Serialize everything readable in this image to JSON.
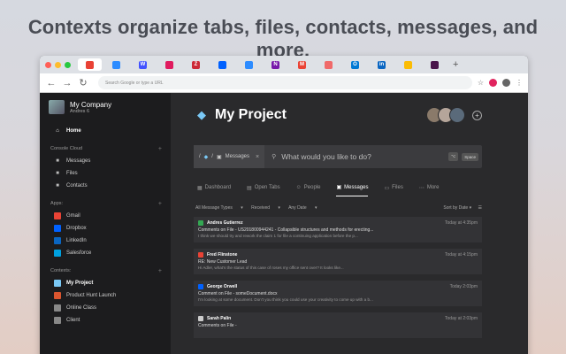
{
  "headline": "Contexts organize tabs, files, contacts, messages, and more.",
  "colors": {
    "accent": "#7ac8f5",
    "dark_bg": "#2a2a2c",
    "sidebar_bg": "#1c1c1e"
  },
  "browser": {
    "omnibox_placeholder": "Search Google or type a URL",
    "tabs": [
      {
        "icon": "chrome-app-icon",
        "color": "#e94235",
        "text": ""
      },
      {
        "icon": "zoom-icon",
        "color": "#2d8cff",
        "text": ""
      },
      {
        "icon": "webflow-icon",
        "color": "#4353ff",
        "text": "W"
      },
      {
        "icon": "toggl-icon",
        "color": "#e01b5f",
        "text": ""
      },
      {
        "icon": "zotero-icon",
        "color": "#cc2936",
        "text": "Z"
      },
      {
        "icon": "dropbox-icon",
        "color": "#0061ff",
        "text": ""
      },
      {
        "icon": "zoom-icon-2",
        "color": "#2d8cff",
        "text": ""
      },
      {
        "icon": "onenote-icon",
        "color": "#7719aa",
        "text": "N"
      },
      {
        "icon": "gmail-icon",
        "color": "#ea4335",
        "text": "M"
      },
      {
        "icon": "app-icon",
        "color": "#f06a6a",
        "text": ""
      },
      {
        "icon": "outlook-icon",
        "color": "#0078d4",
        "text": "O"
      },
      {
        "icon": "linkedin-icon",
        "color": "#0a66c2",
        "text": "in"
      },
      {
        "icon": "photos-icon",
        "color": "#fbbc04",
        "text": ""
      },
      {
        "icon": "slack-icon",
        "color": "#4a154b",
        "text": ""
      }
    ]
  },
  "sidebar": {
    "company": "My Company",
    "user": "Andres 6",
    "home": "Home",
    "cc_section": "Console Cloud",
    "cc_items": [
      {
        "label": "Messages",
        "icon": "inbox-icon"
      },
      {
        "label": "Files",
        "icon": "folder-icon"
      },
      {
        "label": "Contacts",
        "icon": "contact-icon"
      }
    ],
    "apps_section": "Apps:",
    "apps": [
      {
        "label": "Gmail",
        "icon": "gmail-icon",
        "color": "#ea4335"
      },
      {
        "label": "Dropbox",
        "icon": "dropbox-icon",
        "color": "#0061ff"
      },
      {
        "label": "LinkedIn",
        "icon": "linkedin-icon",
        "color": "#0a66c2"
      },
      {
        "label": "Salesforce",
        "icon": "salesforce-icon",
        "color": "#00a1e0"
      }
    ],
    "contexts_section": "Contexts:",
    "contexts": [
      {
        "label": "My Project",
        "icon": "gem-icon",
        "color": "#7ac8f5",
        "bold": true
      },
      {
        "label": "Product Hunt Launch",
        "icon": "producthunt-icon",
        "color": "#da552f",
        "bold": false
      },
      {
        "label": "Online Class",
        "icon": "class-icon",
        "color": "#888",
        "bold": false
      },
      {
        "label": "Client",
        "icon": "client-icon",
        "color": "#888",
        "bold": false
      }
    ]
  },
  "main": {
    "title": "My Project",
    "breadcrumb_label": "Messages",
    "command_placeholder": "What would you like to do?",
    "kbd_1": "⌥",
    "kbd_2": "Space",
    "tabs": [
      "Dashboard",
      "Open Tabs",
      "People",
      "Messages",
      "Files",
      "More"
    ],
    "active_tab": "Messages",
    "filters": [
      "All Message Types",
      "Received",
      "Any Date"
    ],
    "sort": "Sort by Date",
    "messages": [
      {
        "from": "Andres Gutierrez",
        "icon_color": "#34a853",
        "time": "Today at 4:35pm",
        "subject": "Comments on File - US201800944241 - Collapsible structures and methods for erecting...",
        "body": "I think we should try and rework the claim 1 for file a continuing application before the p..."
      },
      {
        "from": "Fred Flinstone",
        "icon_color": "#ea4335",
        "time": "Today at 4:15pm",
        "subject": "RE: New Customer Lead",
        "body": "Hi Adler, what's the status of this case of roses my office sent over? It looks like..."
      },
      {
        "from": "George Orwell",
        "icon_color": "#0061ff",
        "time": "Today 2:03pm",
        "subject": "Comment on File - someDocument.docx",
        "body": "I'm looking at some document. Don't you think you could use your creativity to come up with a b..."
      },
      {
        "from": "Sarah Palin",
        "icon_color": "#cccccc",
        "time": "Today at 2:03pm",
        "subject": "Comments on File - ",
        "body": ""
      }
    ]
  }
}
